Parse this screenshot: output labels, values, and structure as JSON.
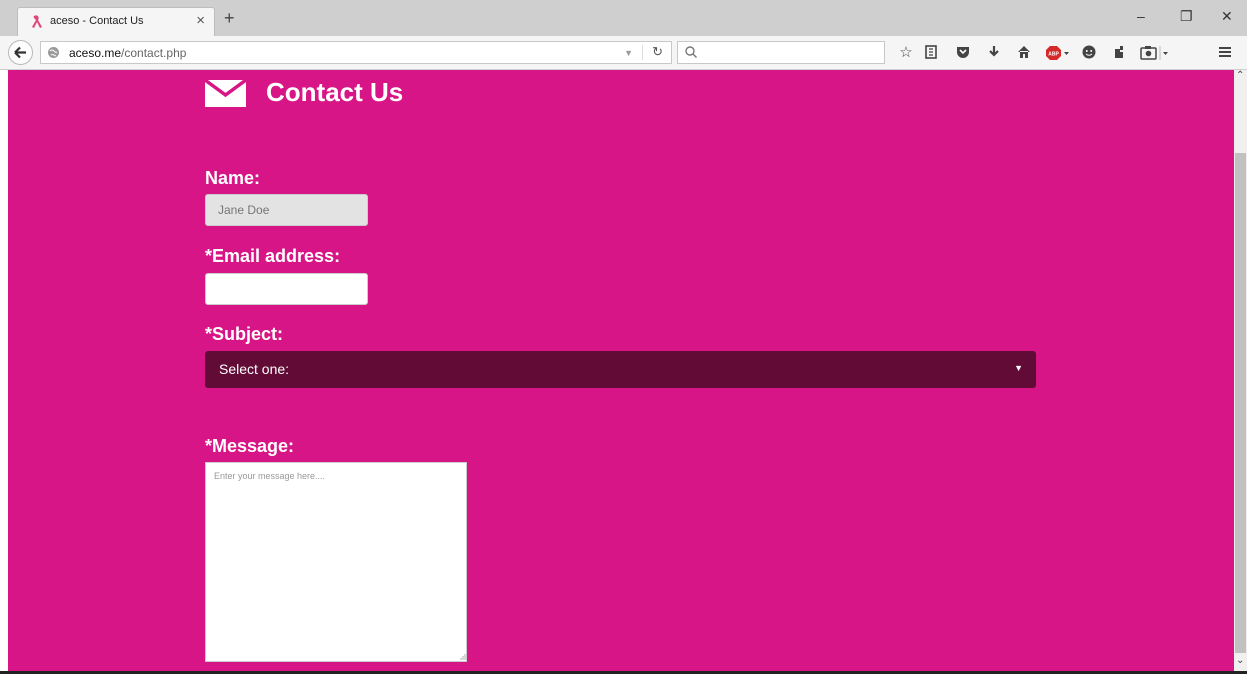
{
  "browser": {
    "tab": {
      "title": "aceso - Contact Us",
      "close_glyph": "×"
    },
    "new_tab_glyph": "+",
    "window_controls": {
      "minimize": "–",
      "restore": "❐",
      "close": "✕"
    },
    "url": {
      "host": "aceso.me",
      "path": "/contact.php"
    },
    "icons": [
      "star-icon",
      "reading-list-icon",
      "pocket-icon",
      "download-icon",
      "home-icon",
      "adblock-icon",
      "chat-icon",
      "extension-icon",
      "screenshot-icon",
      "menu-icon"
    ],
    "adblock_label": "ABP"
  },
  "page": {
    "heading": "Contact Us",
    "name": {
      "label": "Name:",
      "placeholder": "Jane Doe"
    },
    "email": {
      "label": "*Email address:",
      "placeholder": ""
    },
    "subject": {
      "label": "*Subject:",
      "selected": "Select one:"
    },
    "message": {
      "label": "*Message:",
      "placeholder": "Enter your message here...."
    }
  },
  "colors": {
    "page_bg": "#d81586",
    "select_bg": "#620b36",
    "text": "#ffffff"
  }
}
